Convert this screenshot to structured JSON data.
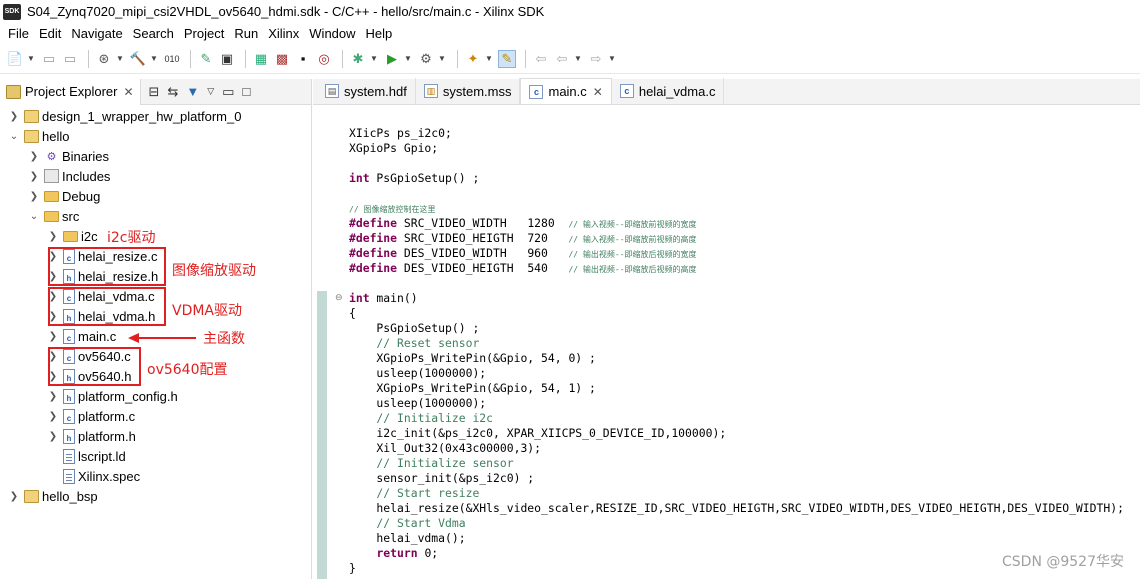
{
  "window": {
    "title": "S04_Zynq7020_mipi_csi2VHDL_ov5640_hdmi.sdk - C/C++ - hello/src/main.c - Xilinx SDK",
    "app_icon_text": "SDK"
  },
  "menu": [
    "File",
    "Edit",
    "Navigate",
    "Search",
    "Project",
    "Run",
    "Xilinx",
    "Window",
    "Help"
  ],
  "explorer": {
    "tab_label": "Project Explorer",
    "items": [
      {
        "label": "design_1_wrapper_hw_platform_0",
        "icon": "project-icon",
        "expand": "collapsed"
      },
      {
        "label": "hello",
        "icon": "project-icon",
        "expand": "expanded"
      },
      {
        "label": "Binaries",
        "icon": "binaries-icon",
        "expand": "collapsed"
      },
      {
        "label": "Includes",
        "icon": "includes-icon",
        "expand": "collapsed"
      },
      {
        "label": "Debug",
        "icon": "folder-icon",
        "expand": "collapsed"
      },
      {
        "label": "src",
        "icon": "folder-icon",
        "expand": "expanded"
      },
      {
        "label": "i2c",
        "icon": "folder-icon",
        "expand": "collapsed"
      },
      {
        "label": "helai_resize.c",
        "icon": "c-file-icon",
        "expand": "collapsed"
      },
      {
        "label": "helai_resize.h",
        "icon": "h-file-icon",
        "expand": "collapsed"
      },
      {
        "label": "helai_vdma.c",
        "icon": "c-file-icon",
        "expand": "collapsed"
      },
      {
        "label": "helai_vdma.h",
        "icon": "h-file-icon",
        "expand": "collapsed"
      },
      {
        "label": "main.c",
        "icon": "c-file-icon",
        "expand": "collapsed"
      },
      {
        "label": "ov5640.c",
        "icon": "c-file-icon",
        "expand": "collapsed"
      },
      {
        "label": "ov5640.h",
        "icon": "h-file-icon",
        "expand": "collapsed"
      },
      {
        "label": "platform_config.h",
        "icon": "h-file-icon",
        "expand": "collapsed"
      },
      {
        "label": "platform.c",
        "icon": "c-file-icon",
        "expand": "collapsed"
      },
      {
        "label": "platform.h",
        "icon": "h-file-icon",
        "expand": "collapsed"
      },
      {
        "label": "lscript.ld",
        "icon": "text-file-icon",
        "expand": "none"
      },
      {
        "label": "Xilinx.spec",
        "icon": "text-file-icon",
        "expand": "none"
      },
      {
        "label": "hello_bsp",
        "icon": "project-icon",
        "expand": "collapsed"
      }
    ],
    "annotations": {
      "i2c": "i2c驱动",
      "resize": "图像缩放驱动",
      "vdma": "VDMA驱动",
      "main": "主函数",
      "ov5640": "ov5640配置"
    }
  },
  "editor": {
    "tabs": [
      {
        "label": "system.hdf",
        "icon": "hdf-file-icon",
        "active": false
      },
      {
        "label": "system.mss",
        "icon": "mss-file-icon",
        "active": false
      },
      {
        "label": "main.c",
        "icon": "c-file-icon",
        "active": true
      },
      {
        "label": "helai_vdma.c",
        "icon": "c-file-icon",
        "active": false
      }
    ],
    "code": [
      {
        "type": "plain",
        "text": "XIicPs ps_i2c0;"
      },
      {
        "type": "plain",
        "text": "XGpioPs Gpio;"
      },
      {
        "type": "blank",
        "text": ""
      },
      {
        "type": "decl",
        "kw": "int",
        "rest": " PsGpioSetup() ;"
      },
      {
        "type": "blank",
        "text": ""
      },
      {
        "type": "comment-small",
        "text": "// 图像缩放控制在这里"
      },
      {
        "type": "define",
        "kw": "#define",
        "rest": " SRC_VIDEO_WIDTH   1280  ",
        "comment": "// 输入视频--即缩放前视频的宽度"
      },
      {
        "type": "define",
        "kw": "#define",
        "rest": " SRC_VIDEO_HEIGTH  720   ",
        "comment": "// 输入视频--即缩放前视频的高度"
      },
      {
        "type": "define",
        "kw": "#define",
        "rest": " DES_VIDEO_WIDTH   960   ",
        "comment": "// 输出视频--即缩放后视频的宽度"
      },
      {
        "type": "define",
        "kw": "#define",
        "rest": " DES_VIDEO_HEIGTH  540   ",
        "comment": "// 输出视频--即缩放后视频的高度"
      },
      {
        "type": "blank",
        "text": ""
      },
      {
        "type": "decl",
        "kw": "int",
        "rest": " main()"
      },
      {
        "type": "plain",
        "text": "{"
      },
      {
        "type": "plain",
        "text": "    PsGpioSetup() ;"
      },
      {
        "type": "comment",
        "text": "    // Reset sensor"
      },
      {
        "type": "plain",
        "text": "    XGpioPs_WritePin(&Gpio, 54, 0) ;"
      },
      {
        "type": "plain",
        "text": "    usleep(1000000);"
      },
      {
        "type": "plain",
        "text": "    XGpioPs_WritePin(&Gpio, 54, 1) ;"
      },
      {
        "type": "plain",
        "text": "    usleep(1000000);"
      },
      {
        "type": "comment",
        "text": "    // Initialize i2c"
      },
      {
        "type": "plain",
        "text": "    i2c_init(&ps_i2c0, XPAR_XIICPS_0_DEVICE_ID,100000);"
      },
      {
        "type": "plain",
        "text": "    Xil_Out32(0x43c00000,3);"
      },
      {
        "type": "comment",
        "text": "    // Initialize sensor"
      },
      {
        "type": "plain",
        "text": "    sensor_init(&ps_i2c0) ;"
      },
      {
        "type": "comment",
        "text": "    // Start resize"
      },
      {
        "type": "plain",
        "text": "    helai_resize(&XHls_video_scaler,RESIZE_ID,SRC_VIDEO_HEIGTH,SRC_VIDEO_WIDTH,DES_VIDEO_HEIGTH,DES_VIDEO_WIDTH);"
      },
      {
        "type": "comment",
        "text": "    // Start Vdma"
      },
      {
        "type": "plain",
        "text": "    helai_vdma();"
      },
      {
        "type": "return",
        "kw": "return",
        "rest": " 0;"
      },
      {
        "type": "plain",
        "text": "}"
      }
    ]
  },
  "watermark": "CSDN @9527华安"
}
